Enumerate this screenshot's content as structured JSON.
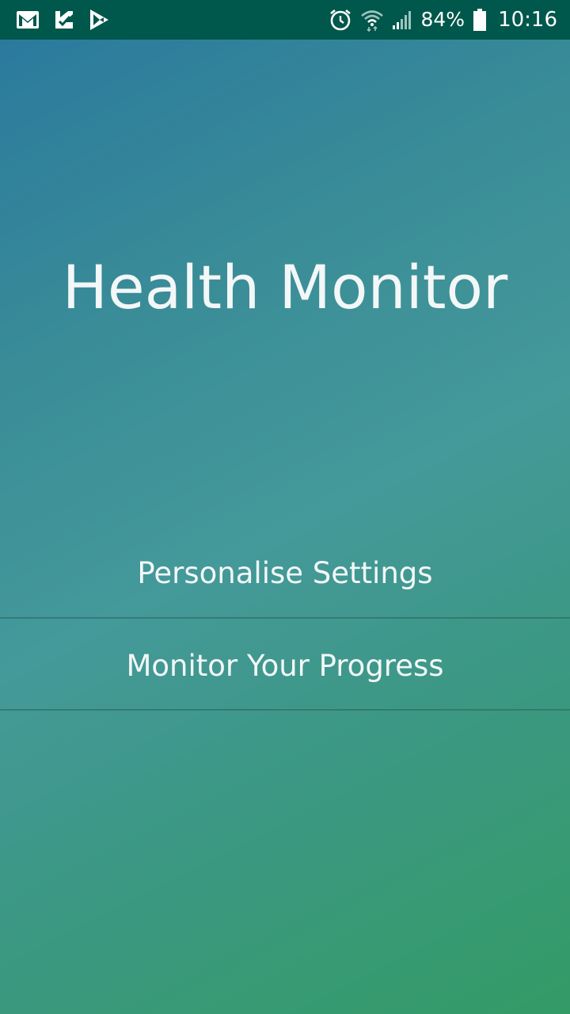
{
  "status_bar": {
    "left_icons": [
      "gmail-icon",
      "task-check-icon",
      "play-store-icon"
    ],
    "right_icons": [
      "alarm-icon",
      "wifi-icon",
      "cell-signal-icon",
      "battery-icon"
    ],
    "battery_percent": "84%",
    "time": "10:16"
  },
  "app": {
    "title": "Health Monitor"
  },
  "menu": {
    "items": [
      {
        "label": "Personalise Settings"
      },
      {
        "label": "Monitor Your Progress"
      }
    ]
  },
  "colors": {
    "status_bar_bg": "#00574b",
    "gradient_top": "#2b7a9e",
    "gradient_bottom": "#339b66",
    "text": "#f3f7f7"
  }
}
